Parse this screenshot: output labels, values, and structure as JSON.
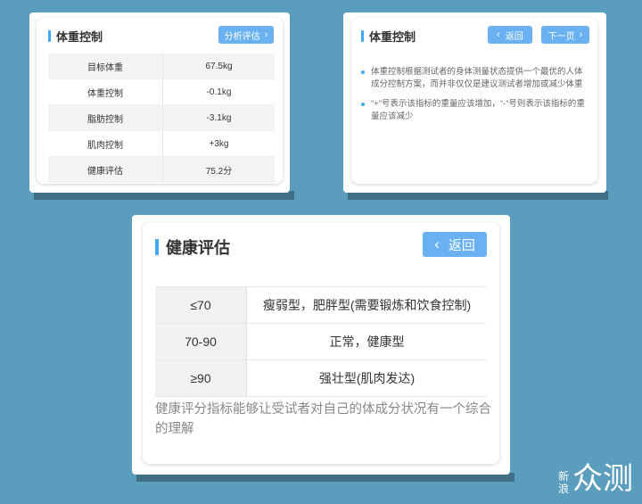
{
  "card1": {
    "title": "体重控制",
    "button_label": "分析评估",
    "rows": [
      {
        "label": "目标体重",
        "value": "67.5kg"
      },
      {
        "label": "体重控制",
        "value": "-0.1kg"
      },
      {
        "label": "脂肪控制",
        "value": "-3.1kg"
      },
      {
        "label": "肌肉控制",
        "value": "+3kg"
      },
      {
        "label": "健康评估",
        "value": "75.2分"
      }
    ]
  },
  "card2": {
    "title": "体重控制",
    "back_label": "返回",
    "next_label": "下一页",
    "bullets": [
      "体重控制根据测试者的身体测量状态提供一个最优的人体成分控制方案，而并非仅仅是建议测试者增加或减少体重",
      "“+”号表示该指标的重量应该增加，“-”号则表示该指标的重量应该减少"
    ]
  },
  "card3": {
    "title": "健康评估",
    "back_label": "返回",
    "rows": [
      {
        "range": "≤70",
        "desc": "瘦弱型，肥胖型(需要锻炼和饮食控制)"
      },
      {
        "range": "70-90",
        "desc": "正常，健康型"
      },
      {
        "range": "≥90",
        "desc": "强壮型(肌肉发达)"
      }
    ],
    "description": "健康评分指标能够让受试者对自己的体成分状况有一个综合的理解"
  },
  "watermark": {
    "small": "新浪",
    "big": "众测"
  },
  "colors": {
    "background": "#5b9dbd",
    "accent": "#3fa9f5",
    "button": "#69b1f0"
  }
}
